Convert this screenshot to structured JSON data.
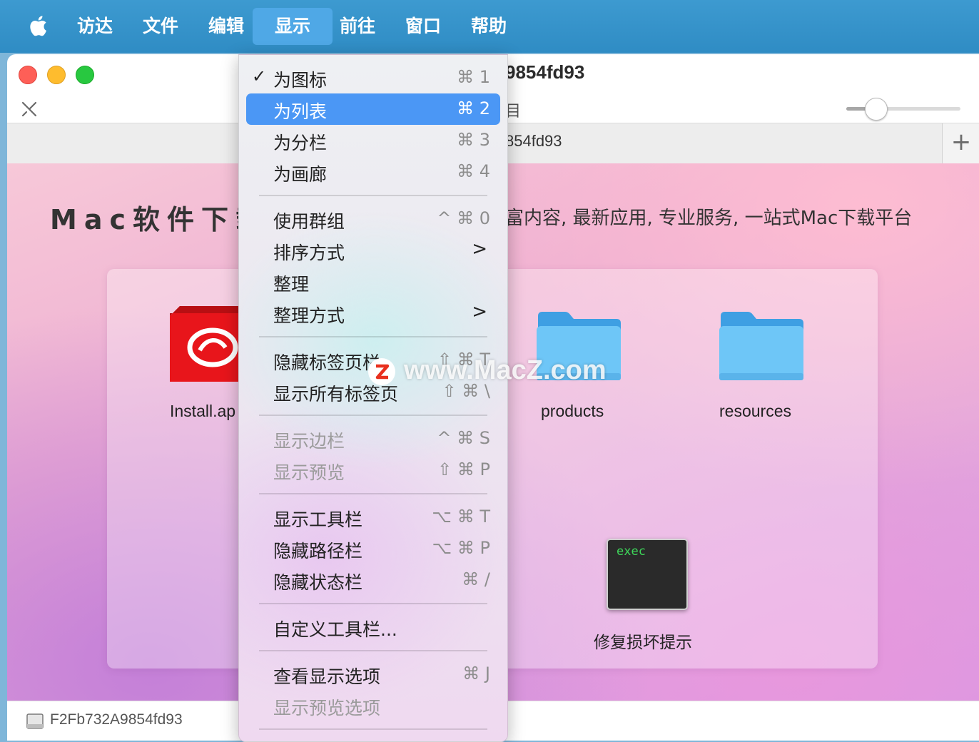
{
  "menubar": {
    "items": [
      {
        "label": "访达"
      },
      {
        "label": "文件"
      },
      {
        "label": "编辑"
      },
      {
        "label": "显示",
        "active": true
      },
      {
        "label": "前往"
      },
      {
        "label": "窗口"
      },
      {
        "label": "帮助"
      }
    ]
  },
  "window": {
    "title": "9854fd93",
    "toolbar_label": "目",
    "tab_label": "854fd93",
    "tab_add": "+",
    "icon_size_level": 0.3,
    "heading_left": "Mac软件下载",
    "heading_right": "富内容, 最新应用, 专业服务, 一站式Mac下载平台",
    "files": [
      {
        "label": "Install.ap",
        "icon": "creative-cloud-icon"
      },
      {
        "label": "products",
        "icon": "folder-icon"
      },
      {
        "label": "resources",
        "icon": "folder-icon"
      },
      {
        "label": "修复损坏提示",
        "icon": "exec-icon",
        "icon_text": "exec"
      }
    ],
    "status": "F2Fb732A9854fd93"
  },
  "menu": {
    "items": [
      {
        "label": "为图标",
        "shortcut": "⌘ 1",
        "checked": true
      },
      {
        "label": "为列表",
        "shortcut": "⌘ 2",
        "selected": true
      },
      {
        "label": "为分栏",
        "shortcut": "⌘ 3"
      },
      {
        "label": "为画廊",
        "shortcut": "⌘ 4"
      },
      {
        "label": "使用群组",
        "shortcut": "^ ⌘ 0"
      },
      {
        "label": "排序方式",
        "submenu": ">"
      },
      {
        "label": "整理"
      },
      {
        "label": "整理方式",
        "submenu": ">"
      },
      {
        "label": "隐藏标签页栏",
        "shortcut": "⇧ ⌘ T"
      },
      {
        "label": "显示所有标签页",
        "shortcut": "⇧ ⌘ \\"
      },
      {
        "label": "显示边栏",
        "shortcut": "^ ⌘ S",
        "disabled": true
      },
      {
        "label": "显示预览",
        "shortcut": "⇧ ⌘ P",
        "disabled": true
      },
      {
        "label": "显示工具栏",
        "shortcut": "⌥ ⌘ T"
      },
      {
        "label": "隐藏路径栏",
        "shortcut": "⌥ ⌘ P"
      },
      {
        "label": "隐藏状态栏",
        "shortcut": "⌘ /"
      },
      {
        "label": "自定义工具栏..."
      },
      {
        "label": "查看显示选项",
        "shortcut": "⌘ J"
      },
      {
        "label": "显示预览选项",
        "disabled": true
      }
    ]
  },
  "watermark": "www.MacZ.com",
  "colors": {
    "menubar": "#3d9ad0",
    "selection": "#4b97f5",
    "folder": "#5fb8f0"
  }
}
